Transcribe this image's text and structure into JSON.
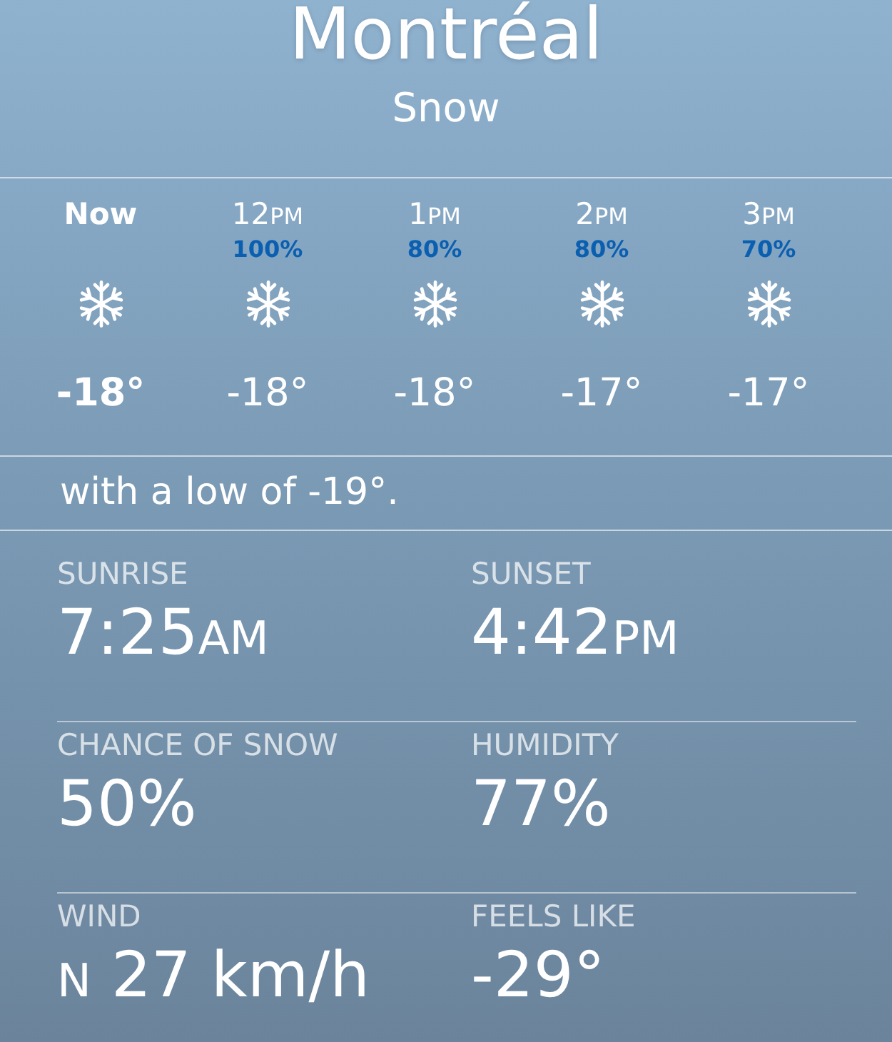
{
  "header": {
    "city": "Montréal",
    "condition": "Snow"
  },
  "hourly": [
    {
      "time": "Now",
      "selected": true,
      "temp": "-18°"
    },
    {
      "time": "12",
      "period": "PM",
      "chance": "100%",
      "selected": false,
      "temp": "-18°"
    },
    {
      "time": "1",
      "period": "PM",
      "chance": "80%",
      "selected": false,
      "temp": "-18°"
    },
    {
      "time": "2",
      "period": "PM",
      "chance": "80%",
      "selected": false,
      "temp": "-17°"
    },
    {
      "time": "3",
      "period": "PM",
      "chance": "70%",
      "selected": false,
      "temp": "-17°"
    }
  ],
  "summary": "with a low of -19°.",
  "details": [
    {
      "label": "SUNRISE",
      "value": "7:25",
      "suffix": "AM"
    },
    {
      "label": "SUNSET",
      "value": "4:42",
      "suffix": "PM"
    },
    {
      "label": "CHANCE OF SNOW",
      "value": "50%"
    },
    {
      "label": "HUMIDITY",
      "value": "77%"
    },
    {
      "label": "WIND",
      "prefix": "N",
      "value": "27 km/h"
    },
    {
      "label": "FEELS LIKE",
      "value": "-29°"
    }
  ]
}
